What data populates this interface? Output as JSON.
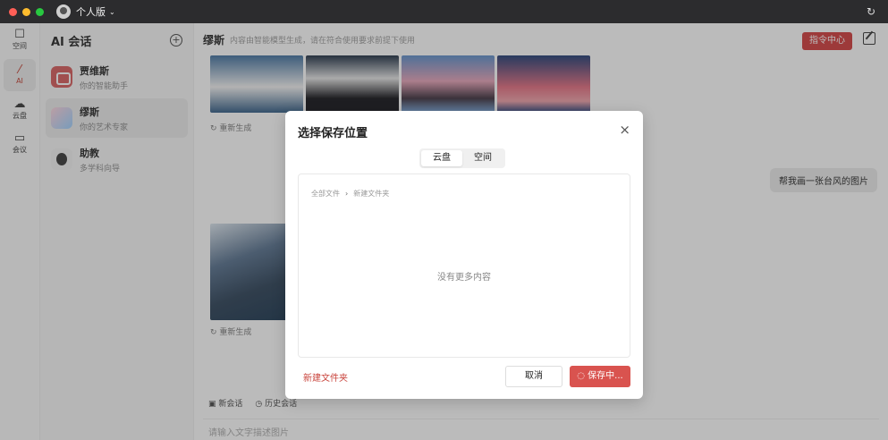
{
  "titlebar": {
    "profile_label": "个人版",
    "chevron": "⌄"
  },
  "rail": {
    "items": [
      {
        "label": "空间",
        "icon": "space-icon"
      },
      {
        "label": "AI",
        "icon": "ai-icon"
      },
      {
        "label": "云盘",
        "icon": "cloud-icon"
      },
      {
        "label": "会议",
        "icon": "video-icon"
      }
    ]
  },
  "conversations": {
    "title": "AI 会话",
    "items": [
      {
        "name": "贾维斯",
        "sub": "你的智能助手"
      },
      {
        "name": "缪斯",
        "sub": "你的艺术专家"
      },
      {
        "name": "助教",
        "sub": "多学科向导"
      }
    ]
  },
  "main": {
    "title": "缪斯",
    "description": "内容由智能模型生成，请在符合使用要求前提下使用",
    "command_center": "指令中心",
    "regenerate_1": "重新生成",
    "regenerate_2": "重新生成",
    "user_message": "帮我画一张台风的图片",
    "new_chat": "新会话",
    "history": "历史会话",
    "input_placeholder": "请输入文字描述图片"
  },
  "dialog": {
    "title": "选择保存位置",
    "tabs": [
      "云盘",
      "空间"
    ],
    "breadcrumb_root": "全部文件",
    "breadcrumb_child": "新建文件夹",
    "empty_text": "没有更多内容",
    "new_folder": "新建文件夹",
    "cancel": "取消",
    "saving": "保存中..."
  }
}
